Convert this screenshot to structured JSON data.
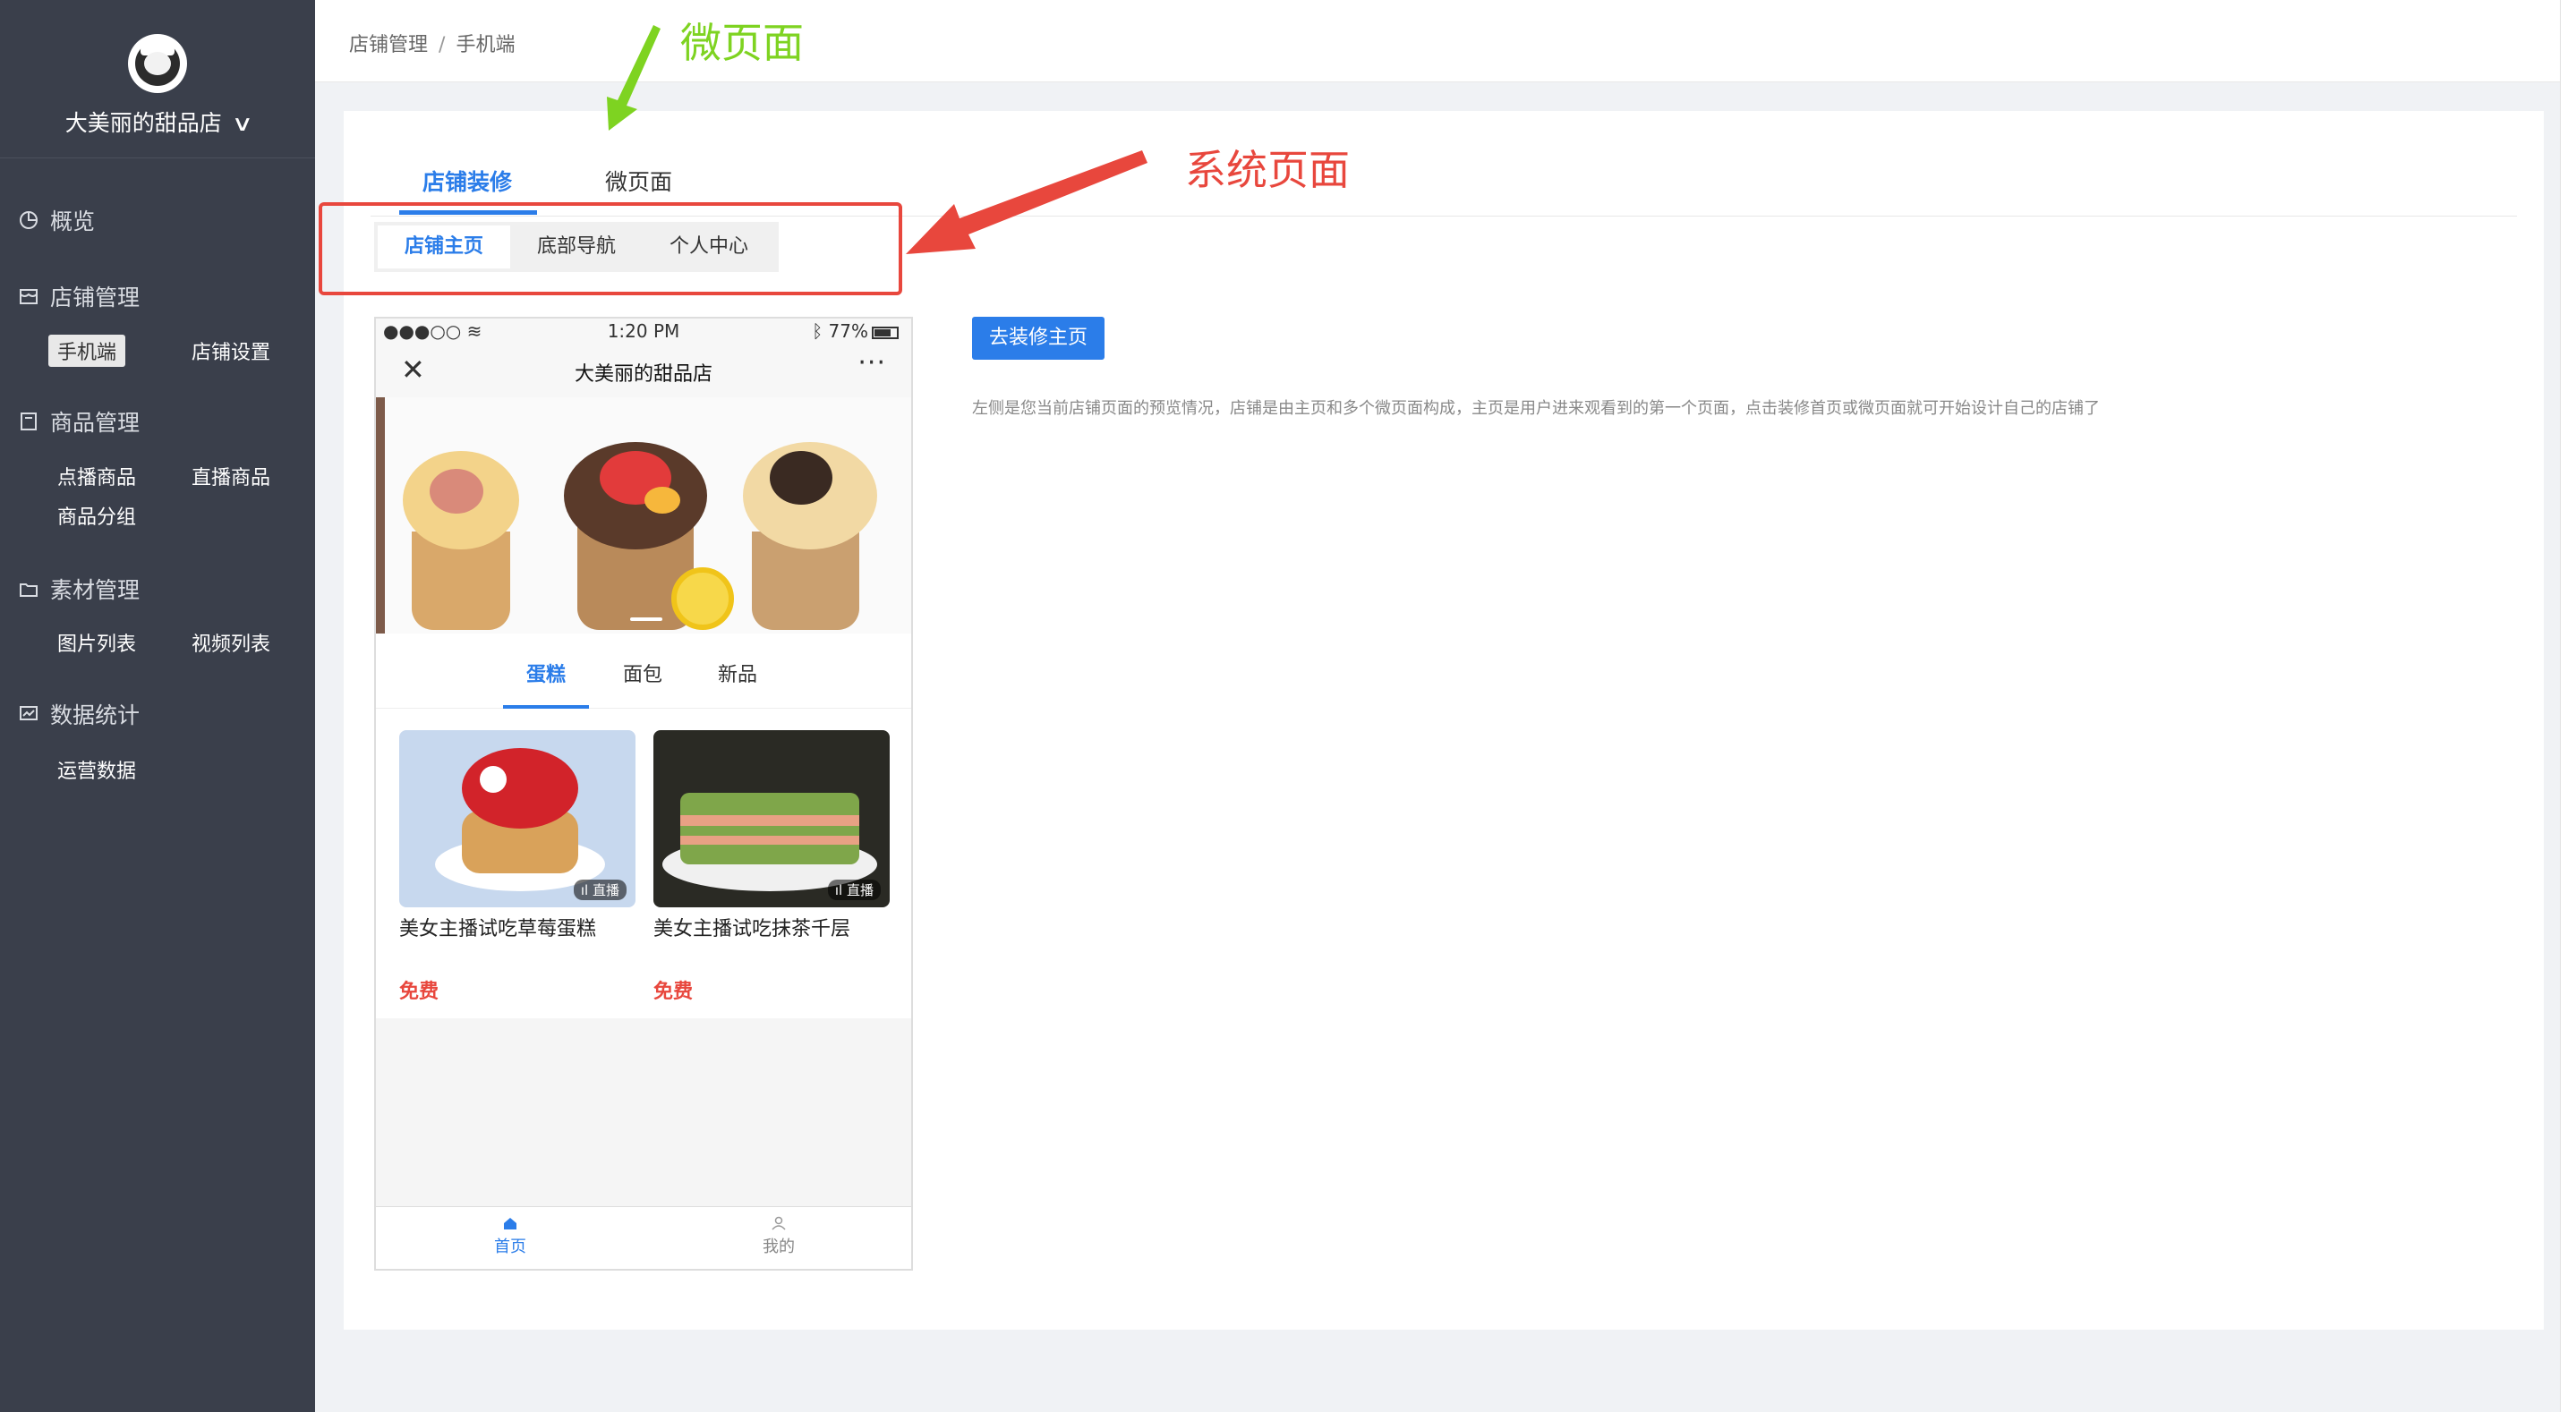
{
  "sidebar": {
    "store_name": "大美丽的甜品店",
    "groups": [
      {
        "label": "概览",
        "icon": "chart-icon"
      },
      {
        "label": "店铺管理",
        "icon": "store-icon",
        "items": [
          "手机端",
          "店铺设置"
        ]
      },
      {
        "label": "商品管理",
        "icon": "goods-icon",
        "items": [
          "点播商品",
          "直播商品",
          "商品分组"
        ]
      },
      {
        "label": "素材管理",
        "icon": "folder-icon",
        "items": [
          "图片列表",
          "视频列表"
        ]
      },
      {
        "label": "数据统计",
        "icon": "stats-icon",
        "items": [
          "运营数据"
        ]
      }
    ],
    "active_item": "手机端"
  },
  "header": {
    "breadcrumb": [
      "店铺管理",
      "手机端"
    ],
    "separator": "/"
  },
  "tabs": [
    {
      "label": "店铺装修",
      "active": true
    },
    {
      "label": "微页面",
      "active": false
    }
  ],
  "segments": [
    {
      "label": "店铺主页",
      "active": true
    },
    {
      "label": "底部导航",
      "active": false
    },
    {
      "label": "个人中心",
      "active": false
    }
  ],
  "phone": {
    "status": {
      "signal": "●●●○○",
      "time": "1:20 PM",
      "battery": "77%"
    },
    "title": "大美丽的甜品店",
    "categories": [
      {
        "label": "蛋糕",
        "active": true
      },
      {
        "label": "面包",
        "active": false
      },
      {
        "label": "新品",
        "active": false
      }
    ],
    "products": [
      {
        "name": "美女主播试吃草莓蛋糕",
        "badge": "直播",
        "price": "免费"
      },
      {
        "name": "美女主播试吃抹茶千层",
        "badge": "直播",
        "price": "免费"
      }
    ],
    "tabbar": [
      {
        "label": "首页",
        "active": true
      },
      {
        "label": "我的",
        "active": false
      }
    ]
  },
  "actions": {
    "decorate_button": "去装修主页",
    "description": "左侧是您当前店铺页面的预览情况，店铺是由主页和多个微页面构成，主页是用户进来观看到的第一个页面，点击装修首页或微页面就可开始设计自己的店铺了"
  },
  "annotations": {
    "micro_page": "微页面",
    "system_page": "系统页面",
    "micro_color": "#7ed321",
    "system_color": "#e8473d"
  },
  "colors": {
    "accent": "#2b7de9",
    "sidebar_bg": "#3a3f4b",
    "price": "#e8473d"
  }
}
